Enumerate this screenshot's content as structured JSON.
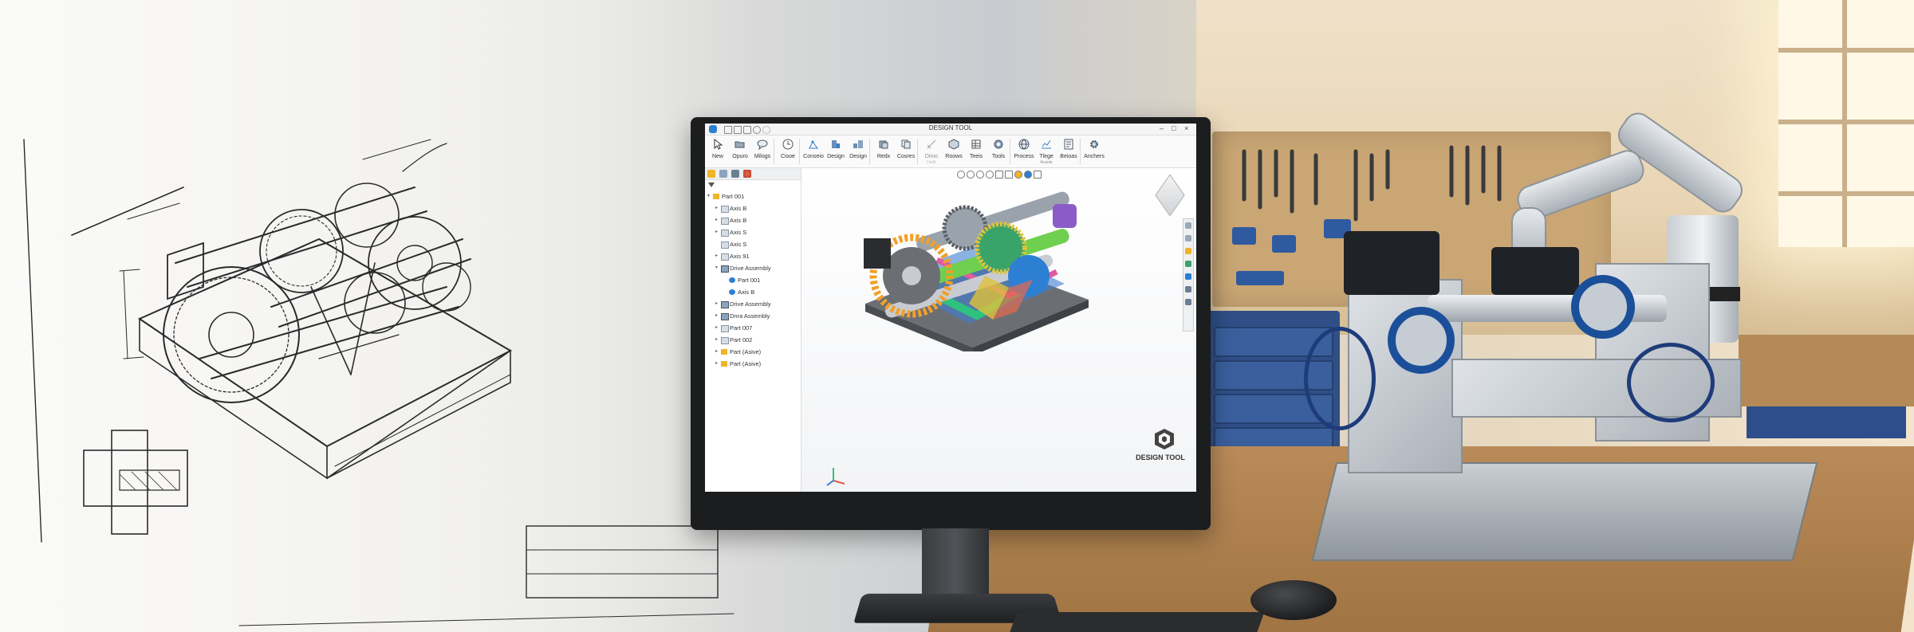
{
  "app": {
    "window_title": "DESIGN TOOL",
    "brand_label": "DESIGN TOOL"
  },
  "ribbon": {
    "buttons": [
      {
        "label": "New",
        "icon": "cursor-icon"
      },
      {
        "label": "Opuro",
        "icon": "folder-open-icon"
      },
      {
        "label": "Milogs",
        "icon": "comment-icon"
      },
      {
        "label": "Cisoe",
        "icon": "clock-icon"
      },
      {
        "label": "Conseio",
        "icon": "sketch-icon"
      },
      {
        "label": "Design",
        "icon": "design-icon"
      },
      {
        "label": "Design",
        "icon": "assembly-icon"
      },
      {
        "label": "Redx",
        "icon": "layers-icon"
      },
      {
        "label": "Cosres",
        "icon": "copy-icon"
      },
      {
        "label": "Dimo",
        "sub": "Dedk",
        "icon": "dimension-icon"
      },
      {
        "label": "Roows",
        "icon": "cube-icon"
      },
      {
        "label": "Teeis",
        "icon": "table-icon"
      },
      {
        "label": "Tools",
        "icon": "tools-icon"
      },
      {
        "label": "Process",
        "icon": "globe-icon"
      },
      {
        "label": "Tlege",
        "sub": "Acaole",
        "icon": "chart-icon"
      },
      {
        "label": "Beioas",
        "icon": "drawing-icon"
      },
      {
        "label": "Anchers",
        "icon": "gear-icon"
      }
    ]
  },
  "tree": {
    "items": [
      {
        "label": "Part 001",
        "level": 0,
        "icon": "folder-icon",
        "expanded": true
      },
      {
        "label": "Axis B",
        "level": 1,
        "icon": "part-icon"
      },
      {
        "label": "Axis B",
        "level": 1,
        "icon": "part-icon"
      },
      {
        "label": "Axis S",
        "level": 1,
        "icon": "part-icon"
      },
      {
        "label": "Axis S",
        "level": 1,
        "icon": "part-icon"
      },
      {
        "label": "Axis 91",
        "level": 1,
        "icon": "part-icon"
      },
      {
        "label": "Drive Assembly",
        "level": 1,
        "icon": "assembly-icon",
        "expanded": true
      },
      {
        "label": "Part 001",
        "level": 2,
        "icon": "globe-icon"
      },
      {
        "label": "Axis B",
        "level": 2,
        "icon": "globe-icon"
      },
      {
        "label": "Drive Assembly",
        "level": 1,
        "icon": "assembly-icon"
      },
      {
        "label": "Dnra Assembly",
        "level": 1,
        "icon": "assembly-icon"
      },
      {
        "label": "Part 007",
        "level": 1,
        "icon": "part-icon"
      },
      {
        "label": "Part 002",
        "level": 1,
        "icon": "part-icon"
      },
      {
        "label": "Part (Asive)",
        "level": 1,
        "icon": "folder-icon"
      },
      {
        "label": "Part (Asive)",
        "level": 1,
        "icon": "folder-icon"
      }
    ]
  },
  "colors": {
    "accent": "#2d7fd3",
    "folder": "#f0b429",
    "machine_blue": "#1b4f9a",
    "cabinet_blue": "#2f4f86"
  }
}
